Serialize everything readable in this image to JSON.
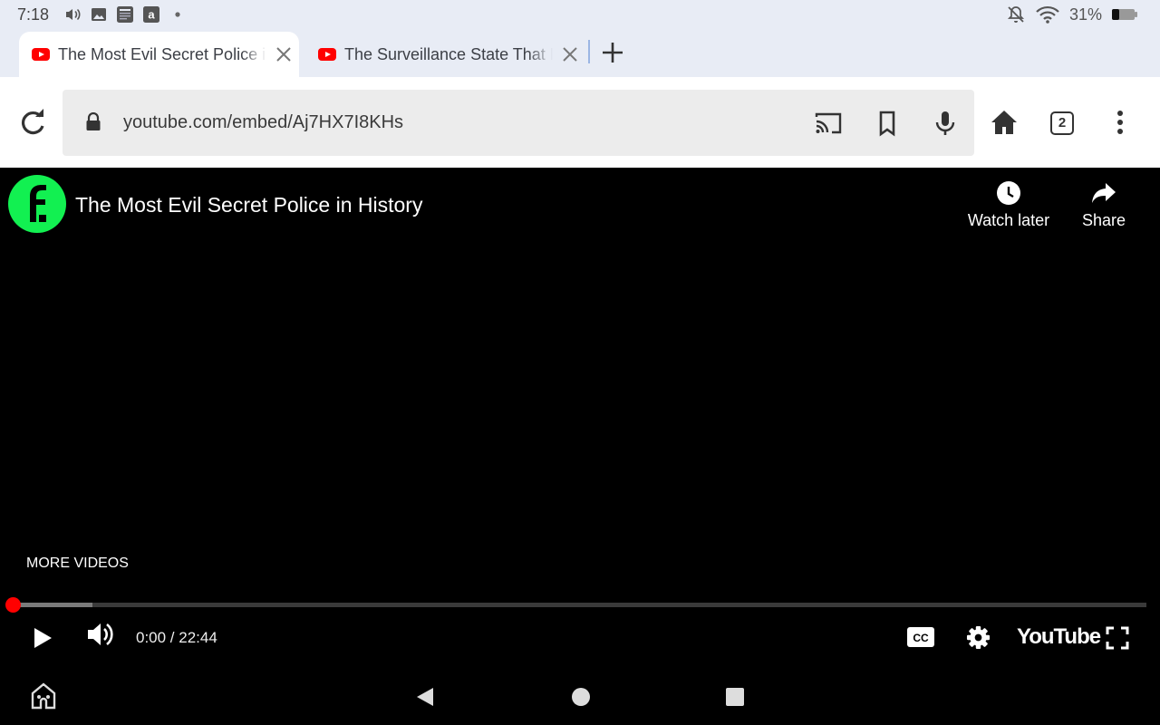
{
  "status_bar": {
    "time": "7:18",
    "battery_text": "31%",
    "left_icons": [
      "volume-icon",
      "image-icon",
      "news-app-icon",
      "amazon-icon",
      "dot-icon"
    ],
    "right_icons": [
      "notifications-off-icon",
      "wifi-icon",
      "battery-icon"
    ]
  },
  "tabs": [
    {
      "title": "The Most Evil Secret Police in History",
      "active": true,
      "favicon": "youtube-icon"
    },
    {
      "title": "The Surveillance State That Didn't Need Computers",
      "active": false,
      "favicon": "youtube-icon"
    }
  ],
  "toolbar": {
    "url": "youtube.com/embed/Aj7HX7I8KHs",
    "tab_count": "2",
    "icons": [
      "reload-icon",
      "lock-icon",
      "cast-icon",
      "bookmark-icon",
      "mic-icon",
      "home-icon",
      "tab-switcher-icon",
      "more-menu-icon"
    ]
  },
  "video": {
    "title": "The Most Evil Secret Police in History",
    "channel_logo_letter": "f.",
    "channel_logo_color": "#12f051",
    "watch_later_label": "Watch later",
    "share_label": "Share",
    "more_videos_label": "MORE VIDEOS",
    "time_display": "0:00 / 22:44",
    "played_fraction": 0.0,
    "buffered_fraction": 0.07,
    "brand_label": "YouTube"
  },
  "colors": {
    "accent_red": "#ff0000",
    "chrome_bg": "#e8ecf5",
    "omnibox_bg": "#ececec"
  }
}
